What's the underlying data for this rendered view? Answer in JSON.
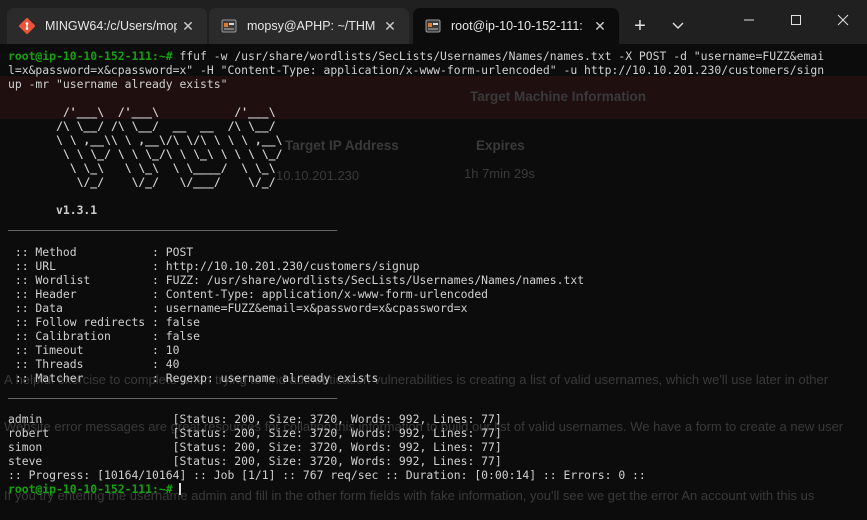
{
  "tabs": [
    {
      "label": "MINGW64:/c/Users/mop",
      "icon": "git-bash-icon",
      "active": false
    },
    {
      "label": "mopsy@APHP: ~/THM",
      "icon": "linux-terminal-icon",
      "active": false
    },
    {
      "label": "root@ip-10-10-152-111:",
      "icon": "linux-terminal-icon",
      "active": true
    }
  ],
  "window_controls": {
    "new_tab": "+",
    "dropdown": "chevron-down-icon",
    "minimize": "minimize-icon",
    "maximize": "maximize-icon",
    "close": "close-icon"
  },
  "background_page": {
    "deploy_header": "Target Machine Information",
    "ip_header": "Target IP Address",
    "expires_header": "Expires",
    "ip_value": "10.10.201.230",
    "expires_value": "1h 7min 29s",
    "paragraph_1": "A helpful exercise to complete when trying to find authentication vulnerabilities is creating a list of valid usernames, which we'll use later in other",
    "paragraph_2": "Website error messages are great resources for collating this information to build our list of valid usernames. We have a form to create a new user",
    "paragraph_3": "If you try entering the username admin and fill in the other form fields with fake information, you'll see we get the error An account with this us"
  },
  "terminal": {
    "prompt": "root@ip-10-10-152-111:~#",
    "command_lines": [
      " ffuf -w /usr/share/wordlists/SecLists/Usernames/Names/names.txt -X POST -d \"username=FUZZ&emai",
      "l=x&password=x&cpassword=x\" -H \"Content-Type: application/x-www-form-urlencoded\" -u http://10.10.201.230/customers/sign",
      "up -mr \"username already exists\""
    ],
    "banner": [
      "        /'___\\  /'___\\           /'___\\",
      "       /\\ \\__/ /\\ \\__/  __  __  /\\ \\__/",
      "       \\ \\ ,__\\\\ \\ ,__\\/\\ \\/\\ \\ \\ \\ ,__\\",
      "        \\ \\ \\_/ \\ \\ \\_/\\ \\ \\_\\ \\ \\ \\ \\_/",
      "         \\ \\_\\   \\ \\_\\  \\ \\____/  \\ \\_\\",
      "          \\/_/    \\/_/   \\/___/    \\/_/"
    ],
    "version": "       v1.3.1",
    "separator": "________________________________________________",
    "config": [
      " :: Method           : POST",
      " :: URL              : http://10.10.201.230/customers/signup",
      " :: Wordlist         : FUZZ: /usr/share/wordlists/SecLists/Usernames/Names/names.txt",
      " :: Header           : Content-Type: application/x-www-form-urlencoded",
      " :: Data             : username=FUZZ&email=x&password=x&cpassword=x",
      " :: Follow redirects : false",
      " :: Calibration      : false",
      " :: Timeout          : 10",
      " :: Threads          : 40",
      " :: Matcher          : Regexp: username already exists"
    ],
    "results": [
      "admin                   [Status: 200, Size: 3720, Words: 992, Lines: 77]",
      "robert                  [Status: 200, Size: 3720, Words: 992, Lines: 77]",
      "simon                   [Status: 200, Size: 3720, Words: 992, Lines: 77]",
      "steve                   [Status: 200, Size: 3720, Words: 992, Lines: 77]"
    ],
    "progress": ":: Progress: [10164/10164] :: Job [1/1] :: 767 req/sec :: Duration: [0:00:14] :: Errors: 0 ::"
  }
}
